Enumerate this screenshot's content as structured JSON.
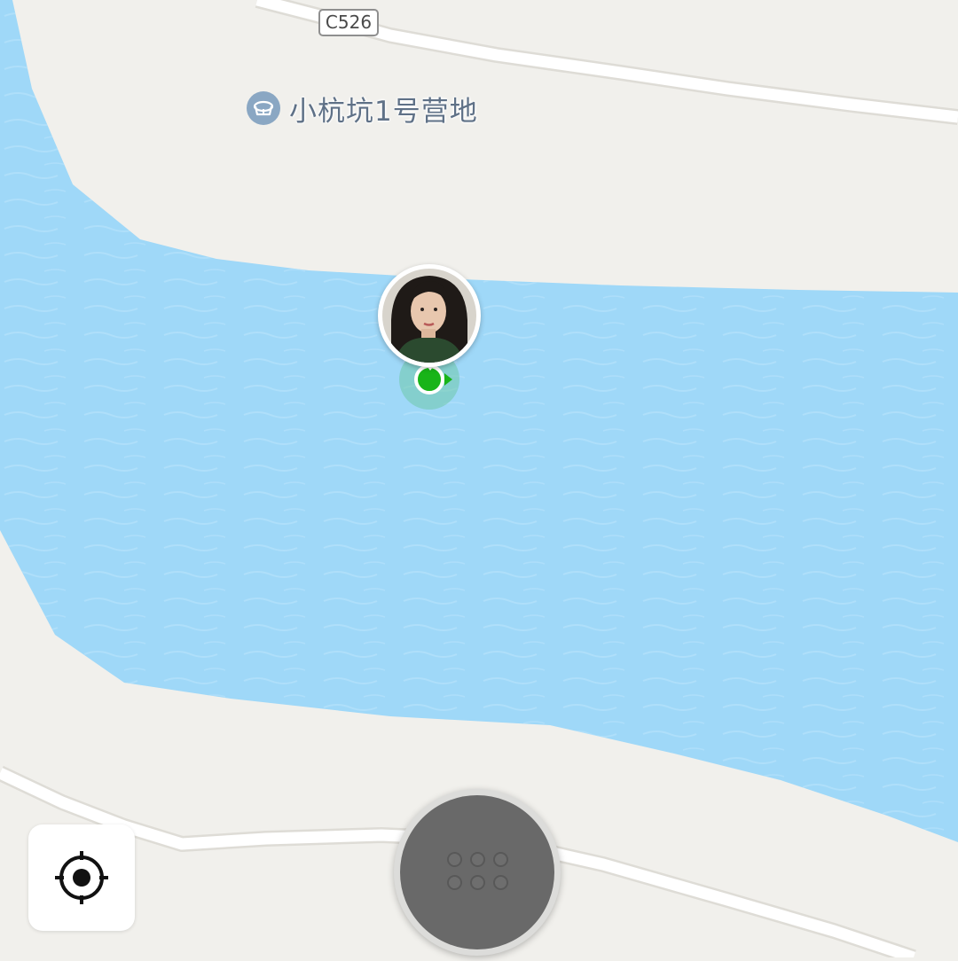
{
  "map": {
    "land_color": "#f1f0ec",
    "water_color": "#9fd8f8",
    "road_color": "#ffffff",
    "road_edge_color": "#dedcd6"
  },
  "road_shield": {
    "label": "C526"
  },
  "poi": {
    "label": "小杭坑1号营地",
    "icon": "campsite-icon",
    "color": "#8aa7c3"
  },
  "user_marker": {
    "avatar": "user-avatar-photo",
    "dot_color": "#18b418"
  },
  "controls": {
    "locate_icon": "crosshair-icon",
    "menu_icon": "six-dots-grid-icon",
    "menu_color": "#696969"
  }
}
